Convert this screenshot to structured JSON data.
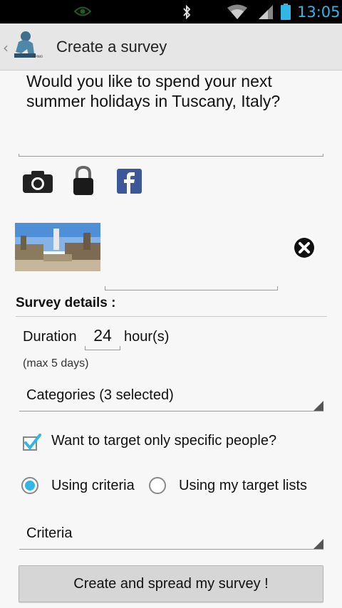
{
  "status_bar": {
    "time": "13:05",
    "icons": [
      "eye-icon",
      "bluetooth-icon",
      "wifi-icon",
      "signal-icon",
      "battery-icon"
    ]
  },
  "action_bar": {
    "title": "Create a survey",
    "logo": "app-logo-thinker-icon"
  },
  "question": {
    "value": "Would you like to spend your next summer holidays in Tuscany, Italy?"
  },
  "attach_icons": [
    "camera-icon",
    "lock-icon",
    "facebook-icon"
  ],
  "photo": {
    "remove_icon": "close-icon"
  },
  "details": {
    "title": "Survey details :",
    "duration_label": "Duration",
    "duration_value": "24",
    "duration_unit": "hour(s)",
    "duration_max": "(max 5 days)",
    "categories": "Categories (3 selected)",
    "target_label": "Want to target only specific people?",
    "target_checked": true,
    "radio_criteria": "Using criteria",
    "radio_lists": "Using my target lists",
    "selected_radio": "Using criteria",
    "criteria": "Criteria"
  },
  "submit_label": "Create and spread my survey !",
  "colors": {
    "accent": "#33b5e5",
    "facebook": "#3b5998",
    "action_bar": "#e6e6e6"
  }
}
